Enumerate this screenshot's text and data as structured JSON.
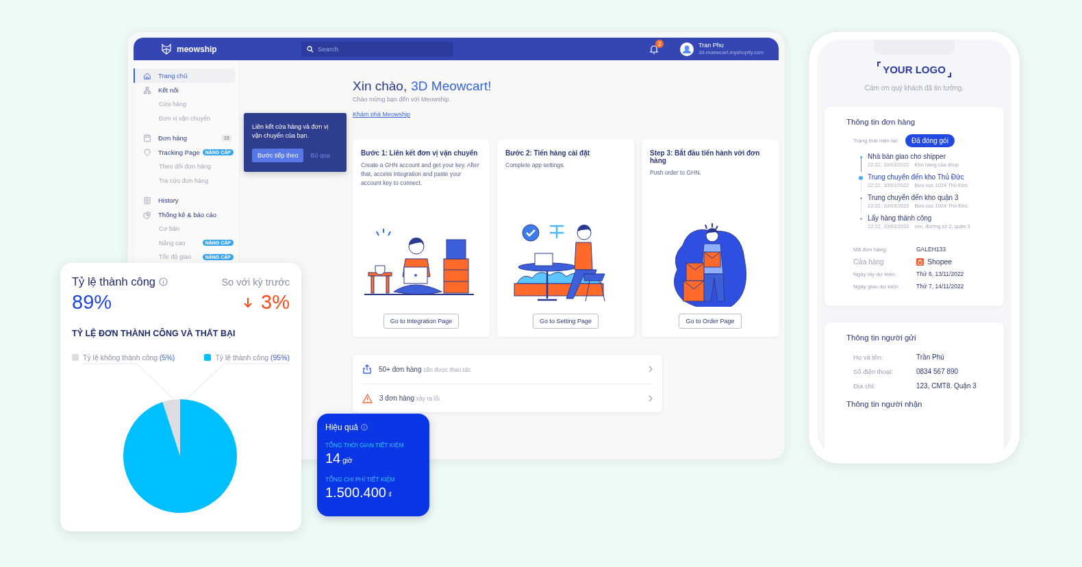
{
  "app": {
    "brand": "meowship",
    "search_placeholder": "Search",
    "notification_count": "2",
    "user": {
      "name": "Tran Phu",
      "shop": "3d-moewcart.myshopify.com"
    }
  },
  "sidebar": {
    "items": [
      {
        "label": "Trang chủ",
        "selected": true
      },
      {
        "label": "Kết nối",
        "selected": false,
        "children": [
          {
            "label": "Cửa hàng",
            "selected": false
          },
          {
            "label": "Đơn vị vận chuyển",
            "selected": false
          }
        ]
      },
      {
        "label": "Đơn hàng",
        "selected": false,
        "count": "15"
      },
      {
        "label": "Tracking Page",
        "selected": false,
        "tag": "NÂNG CẤP",
        "children": [
          {
            "label": "Theo dõi đơn hàng",
            "selected": false
          },
          {
            "label": "Tra cứu đơn hàng",
            "selected": false
          }
        ]
      },
      {
        "label": "History",
        "selected": false
      },
      {
        "label": "Thống kê & báo cáo",
        "selected": false,
        "children": [
          {
            "label": "Cơ bản",
            "selected": false
          },
          {
            "label": "Nâng cao",
            "selected": false,
            "tag": "NÂNG CẤP"
          },
          {
            "label": "Tốc độ giao",
            "selected": false,
            "tag": "NÂNG CẤP"
          }
        ]
      }
    ]
  },
  "greeting": {
    "prefix": "Xin chào,",
    "name": "3D Meowcart!",
    "subtitle": "Chào mừng bạn đến với Meowship.",
    "link": "Khám phá Meowship"
  },
  "tooltip": {
    "text": "Liên kết cửa hàng và đơn vị vận chuyển của bạn.",
    "primary": "Bước tiếp theo",
    "secondary": "Bỏ qua"
  },
  "steps": [
    {
      "kind": "laptop",
      "title": "Bước 1: Liên kết đơn vị vận chuyển",
      "description": "Create a GHN account and get your key. After that, access Integration and paste your account key to connect.",
      "button": "Go to Integration Page"
    },
    {
      "kind": "desk",
      "title": "Bước 2: Tiến hàng cài đặt",
      "description": "Complete app settings.",
      "button": "Go to Setting Page"
    },
    {
      "kind": "boxes",
      "title": "Step 3: Bắt đầu tiến hành với đơn hàng",
      "description": "Push order to GHN.",
      "button": "Go to Order Page"
    }
  ],
  "tasks": [
    {
      "kind": "upload",
      "count": "50+ đơn hàng",
      "note": "cần được thao tác"
    },
    {
      "kind": "warning",
      "count": "3 đơn hàng",
      "note": "xảy ra lỗi"
    }
  ],
  "success_card": {
    "title": "Tỷ lệ thành công",
    "value": "89%",
    "compare_label": "So với kỳ trước",
    "change": "3%",
    "chart_title": "TỶ LỆ ĐƠN THÀNH CÔNG VÀ THẤT BẠI",
    "legend_values": [
      {
        "value": "(5%)",
        "color": "#dcdce2"
      },
      {
        "value": "(95%)",
        "color": "#00bfff"
      }
    ],
    "chart_data": {
      "type": "pie",
      "categories": [
        "Tỷ lệ không thành công",
        "Tỷ lệ thành công"
      ],
      "values": [
        5,
        95
      ],
      "legend": "top"
    }
  },
  "efficiency": {
    "title": "Hiệu quả",
    "metrics": [
      {
        "label": "TỔNG THỜI GIAN TIẾT KIỆM",
        "value": "14",
        "unit": "giờ"
      },
      {
        "label": "TỔNG CHI PHÍ TIẾT KIỆM",
        "value": "1.500.400",
        "unit": "₫"
      }
    ]
  },
  "phone": {
    "logo": "YOUR LOGO",
    "thanks": "Cám ơn quý khách đã tin tưởng.",
    "order": {
      "title": "Thông tin đơn hàng",
      "status_label": "Trạng thái hiện tại:",
      "status": "Đã đóng gói",
      "timeline": [
        {
          "title": "Nhà bán giao cho shipper",
          "time": "22:22, 10/03/2022",
          "place": "Kho hàng của shop",
          "done": true,
          "current": false
        },
        {
          "title": "Trung chuyển đến kho Thủ Đức",
          "time": "22:22, 10/03/2022",
          "place": "Bưu cục 1024 Thủ Đức",
          "done": true,
          "current": true
        },
        {
          "title": "Trung chuyển đến kho quận 3",
          "time": "22:22, 10/03/2022",
          "place": "Bưu cục 1024 Thủ Đức",
          "done": false,
          "current": false
        },
        {
          "title": "Lấy hàng thành công",
          "time": "22:22, 10/03/2022",
          "place": "xxx, đường số 2, quận 3",
          "done": false,
          "current": false
        }
      ],
      "details": [
        {
          "kind": "text",
          "label": "Mã đơn hàng:",
          "value": "GALEH133"
        },
        {
          "kind": "store",
          "label": "Cửa hàng",
          "value": "Shopee"
        },
        {
          "kind": "text",
          "label": "Ngày lấy dự kiến:",
          "value": "Thứ 6, 13/11/2022"
        },
        {
          "kind": "text",
          "label": "Ngày giao dự kiến:",
          "value": "Thứ 7, 14/11/2022"
        }
      ]
    },
    "sender": {
      "title": "Thông tin người gửi",
      "details": [
        {
          "label": "Họ và tên:",
          "value": "Trần Phú"
        },
        {
          "label": "Số điện thoại:",
          "value": "0834 567 890"
        },
        {
          "label": "Địa chỉ:",
          "value": "123, CMT8. Quận 3"
        }
      ]
    },
    "receiver_title": "Thông tin người nhận"
  }
}
